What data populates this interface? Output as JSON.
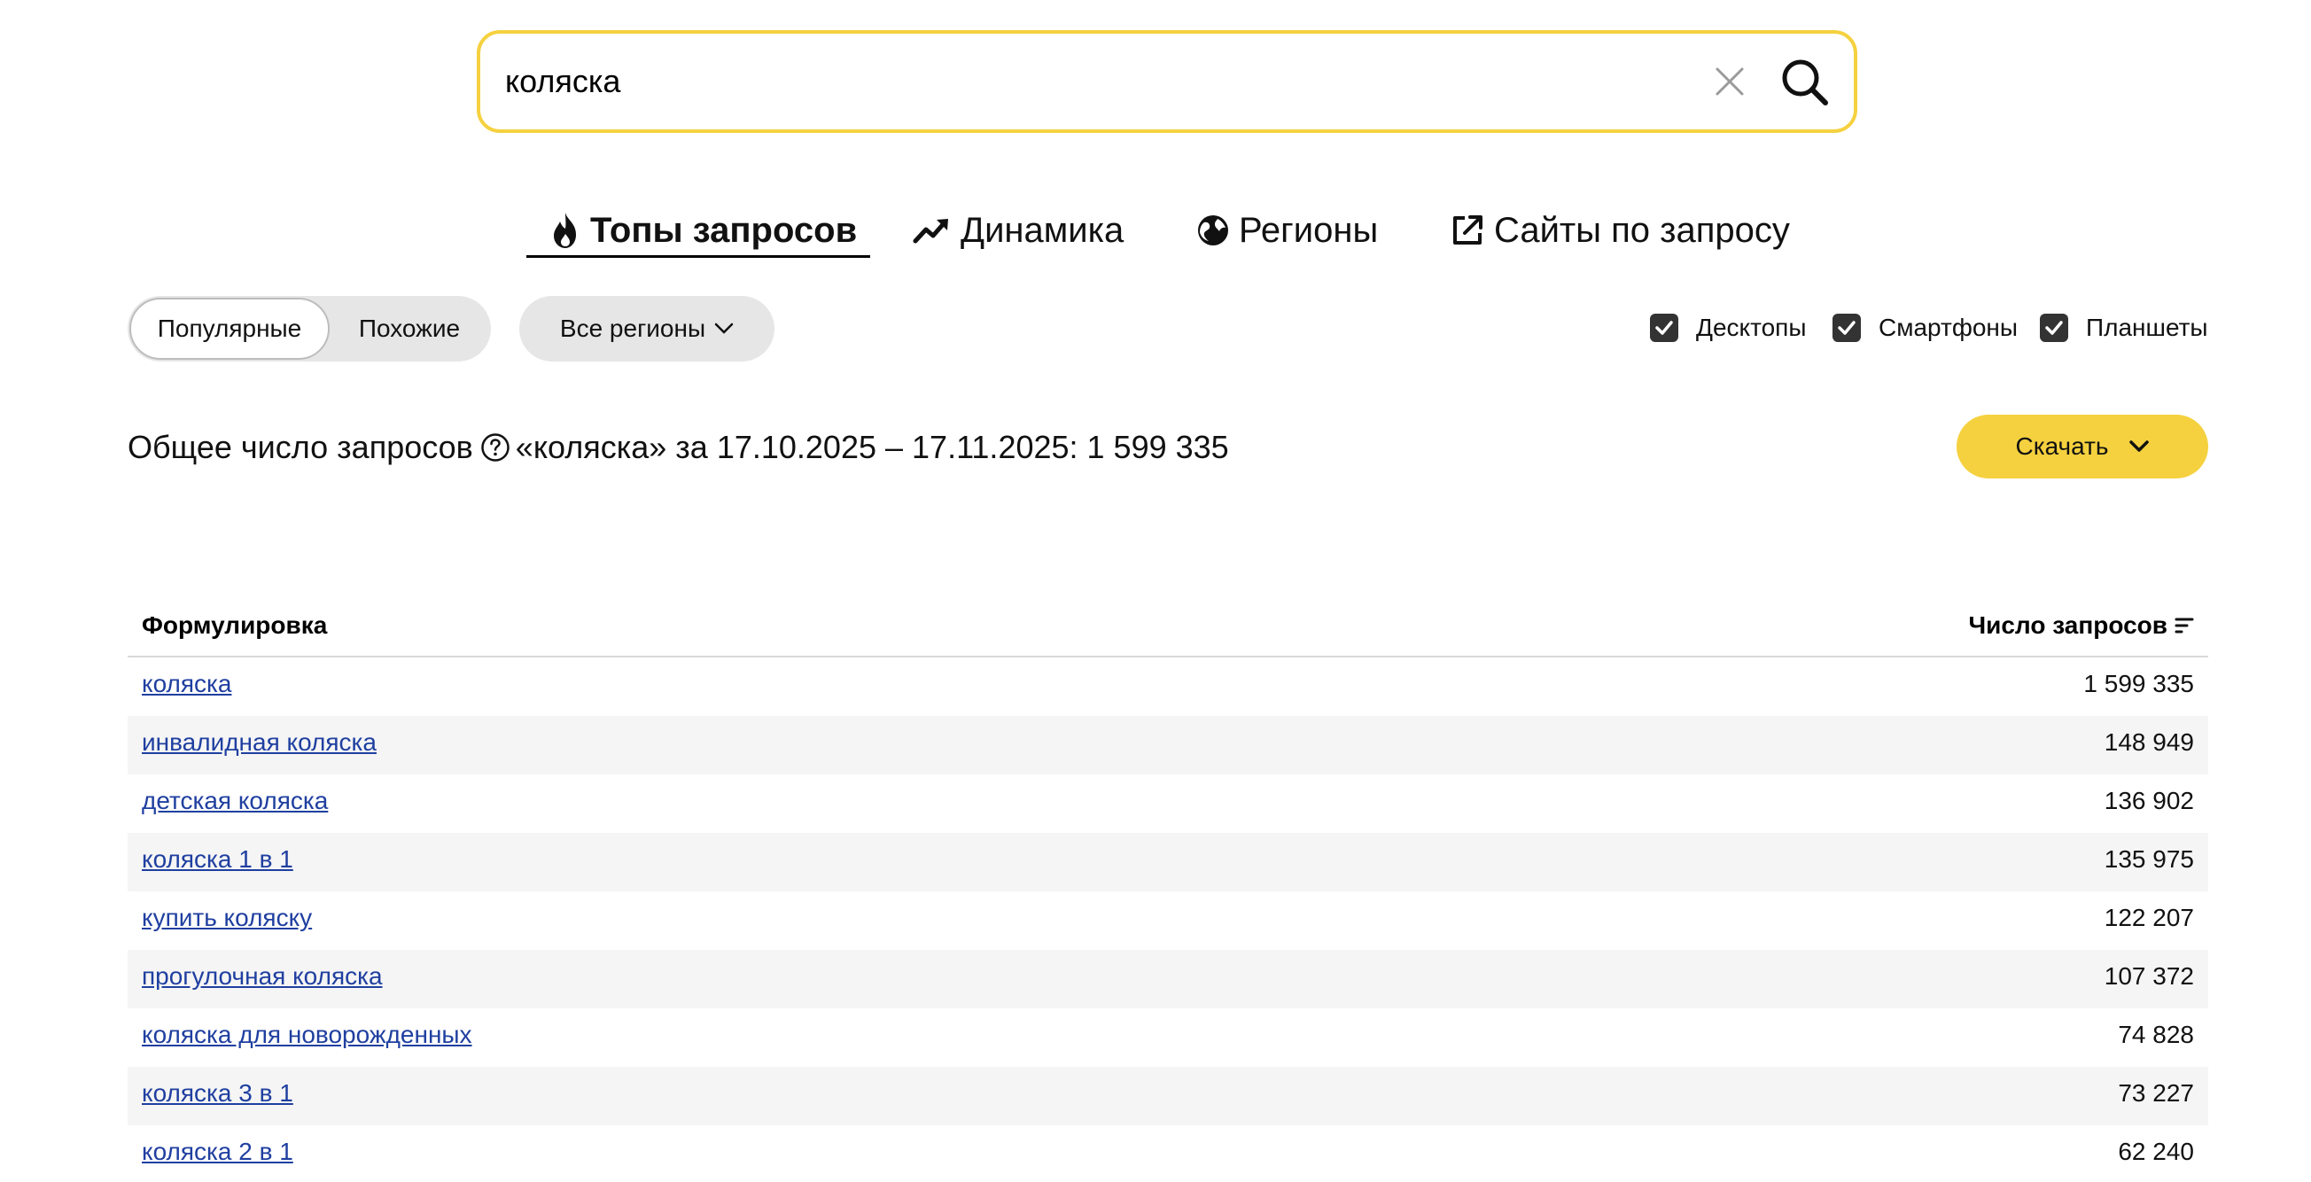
{
  "search": {
    "value": "коляска"
  },
  "tabs": [
    {
      "label": "Топы запросов",
      "icon": "fire-icon",
      "active": true
    },
    {
      "label": "Динамика",
      "icon": "trend-icon"
    },
    {
      "label": "Регионы",
      "icon": "globe-icon"
    },
    {
      "label": "Сайты по запросу",
      "icon": "external-link-icon"
    }
  ],
  "segment": {
    "popular": "Популярные",
    "similar": "Похожие"
  },
  "regions": {
    "label": "Все регионы"
  },
  "devices": {
    "desktop": "Десктопы",
    "smartphones": "Смартфоны",
    "tablets": "Планшеты"
  },
  "summary": {
    "prefix": "Общее число запросов",
    "text": "«коляска» за 17.10.2025 – 17.11.2025: 1 599 335"
  },
  "download": {
    "label": "Скачать"
  },
  "table": {
    "col_phrase": "Формулировка",
    "col_count": "Число запросов",
    "rows": [
      {
        "phrase": "коляска",
        "count": "1 599 335"
      },
      {
        "phrase": "инвалидная коляска",
        "count": "148 949"
      },
      {
        "phrase": "детская коляска",
        "count": "136 902"
      },
      {
        "phrase": "коляска 1 в 1",
        "count": "135 975"
      },
      {
        "phrase": "купить коляску",
        "count": "122 207"
      },
      {
        "phrase": "прогулочная коляска",
        "count": "107 372"
      },
      {
        "phrase": "коляска для новорожденных",
        "count": "74 828"
      },
      {
        "phrase": "коляска 3 в 1",
        "count": "73 227"
      },
      {
        "phrase": "коляска 2 в 1",
        "count": "62 240"
      }
    ]
  },
  "colors": {
    "accent": "#f5d13f",
    "link": "#1f3fa0"
  }
}
